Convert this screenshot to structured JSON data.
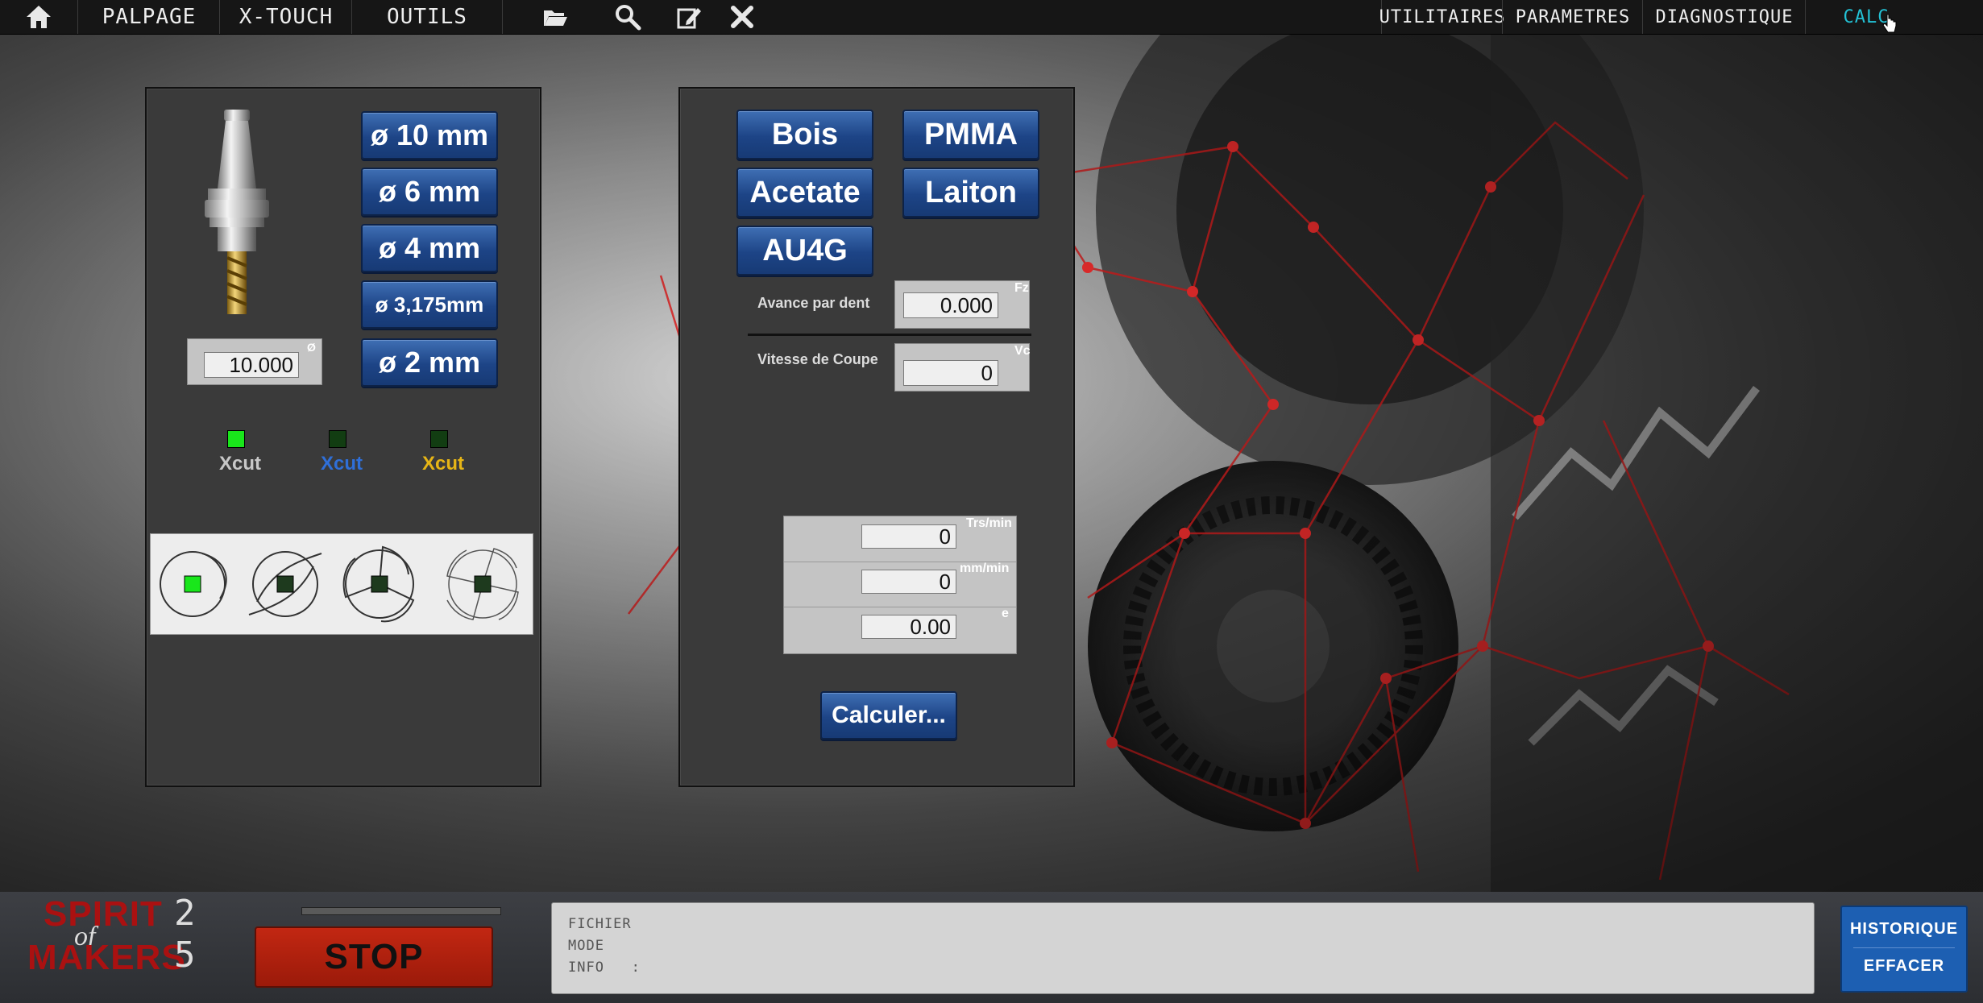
{
  "topbar": {
    "home_icon": "home-icon",
    "menu": [
      "PALPAGE",
      "X-TOUCH",
      "OUTILS"
    ],
    "tools": [
      "folder-open-icon",
      "search-icon",
      "edit-icon",
      "close-icon"
    ],
    "right_menu": [
      "UTILITAIRES",
      "PARAMETRES",
      "DIAGNOSTIQUE",
      "CALC"
    ]
  },
  "tool_panel": {
    "diameter_buttons": [
      "ø 10 mm",
      "ø 6 mm",
      "ø 4 mm",
      "ø 3,175mm",
      "ø 2 mm"
    ],
    "diameter_value": "10.000",
    "diameter_tag": "Ø",
    "xcut": [
      {
        "label": "Xcut",
        "color": "#c8c8c8",
        "led": "#19e61b"
      },
      {
        "label": "Xcut",
        "color": "#2f6fd8",
        "led": "#123d12"
      },
      {
        "label": "Xcut",
        "color": "#e6b516",
        "led": "#123d12"
      }
    ],
    "flute_selector": [
      "1-flute-icon",
      "2-flute-icon",
      "3-flute-icon",
      "4-flute-icon"
    ],
    "flute_selected": 0
  },
  "material_panel": {
    "materials": [
      "Bois",
      "PMMA",
      "Acetate",
      "Laiton",
      "AU4G"
    ],
    "feed_per_tooth_label": "Avance par dent",
    "feed_per_tooth_value": "0.000",
    "feed_per_tooth_tag": "Fz",
    "cutting_speed_label": "Vitesse de Coupe",
    "cutting_speed_value": "0",
    "cutting_speed_tag": "Vc",
    "results": [
      {
        "value": "0",
        "unit": "Trs/min"
      },
      {
        "value": "0",
        "unit": "mm/min"
      },
      {
        "value": "0.00",
        "unit": "e"
      }
    ],
    "calculate_label": "Calculer..."
  },
  "bottombar": {
    "logo_line1": "SPIRIT",
    "logo_mid": "of",
    "logo_line2": "MAKERS",
    "logo_num_top": "2",
    "logo_num_bottom": "5",
    "stop_label": "STOP",
    "info_lines": [
      "FICHIER",
      "MODE",
      "INFO   :"
    ],
    "historique_label": "HISTORIQUE",
    "effacer_label": "EFFACER"
  },
  "colors": {
    "accent_blue": "#1d4486",
    "calc_active": "#23c2d6",
    "stop_red": "#c22712",
    "led_on": "#19e61b"
  }
}
